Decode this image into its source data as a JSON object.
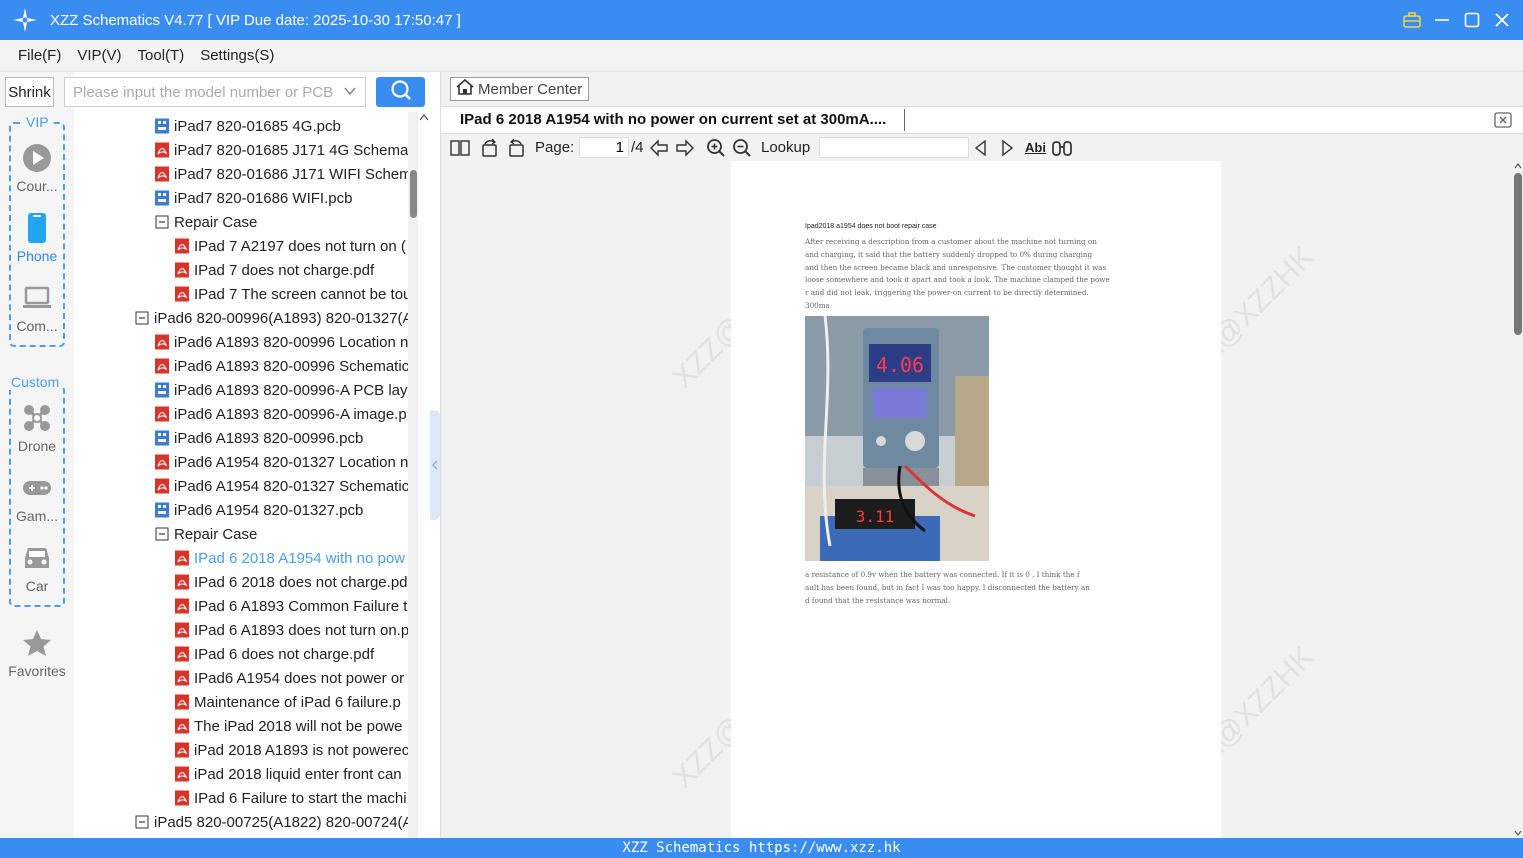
{
  "window": {
    "title": "XZZ Schematics V4.77 [ VIP Due date: 2025-10-30 17:50:47 ]"
  },
  "menu": {
    "items": [
      "File(F)",
      "VIP(V)",
      "Tool(T)",
      "Settings(S)"
    ]
  },
  "rail": {
    "shrink_label": "Shrink",
    "vip_group_label": "VIP",
    "custom_group_label": "Custom",
    "items": {
      "course": "Cour...",
      "phone": "Phone",
      "computer": "Com...",
      "drone": "Drone",
      "game": "Gam...",
      "car": "Car",
      "favorites": "Favorites"
    }
  },
  "search": {
    "placeholder": "Please input the model number or PCB"
  },
  "tree": {
    "rows": [
      {
        "label": "iPad7 820-01685 4G.pcb",
        "type": "pcb",
        "indent": 1
      },
      {
        "label": "iPad7 820-01685 J171 4G Schemat",
        "type": "pdf",
        "indent": 1
      },
      {
        "label": "iPad7 820-01686 J171 WIFI Schem",
        "type": "pdf",
        "indent": 1
      },
      {
        "label": "iPad7 820-01686 WIFI.pcb",
        "type": "pcb",
        "indent": 1
      },
      {
        "label": "Repair Case",
        "type": "folder",
        "indent": 1
      },
      {
        "label": "IPad 7 A2197 does not turn on (",
        "type": "pdf",
        "indent": 2
      },
      {
        "label": "IPad 7 does not charge.pdf",
        "type": "pdf",
        "indent": 2
      },
      {
        "label": "IPad 7 The screen cannot be tou",
        "type": "pdf",
        "indent": 2
      },
      {
        "label": "iPad6 820-00996(A1893) 820-01327(A",
        "type": "folder",
        "indent": 0
      },
      {
        "label": "iPad6 A1893 820-00996 Location n",
        "type": "pdf",
        "indent": 1
      },
      {
        "label": "iPad6 A1893 820-00996 Schematic",
        "type": "pdf",
        "indent": 1
      },
      {
        "label": "iPad6 A1893 820-00996-A PCB laye",
        "type": "pcb",
        "indent": 1
      },
      {
        "label": "iPad6 A1893 820-00996-A image.p",
        "type": "pdf",
        "indent": 1
      },
      {
        "label": "iPad6 A1893 820-00996.pcb",
        "type": "pcb",
        "indent": 1
      },
      {
        "label": "iPad6 A1954 820-01327 Location n",
        "type": "pdf",
        "indent": 1
      },
      {
        "label": "iPad6 A1954 820-01327 Schematic",
        "type": "pdf",
        "indent": 1
      },
      {
        "label": "iPad6 A1954 820-01327.pcb",
        "type": "pcb",
        "indent": 1
      },
      {
        "label": "Repair Case",
        "type": "folder",
        "indent": 1
      },
      {
        "label": "IPad 6 2018 A1954 with no pow",
        "type": "pdf",
        "indent": 2,
        "selected": true
      },
      {
        "label": "IPad 6 2018 does not charge.pd",
        "type": "pdf",
        "indent": 2
      },
      {
        "label": "IPad 6 A1893 Common Failure t",
        "type": "pdf",
        "indent": 2
      },
      {
        "label": "IPad 6 A1893 does not turn on.p",
        "type": "pdf",
        "indent": 2
      },
      {
        "label": "IPad 6 does not charge.pdf",
        "type": "pdf",
        "indent": 2
      },
      {
        "label": "IPad6 A1954 does not power or",
        "type": "pdf",
        "indent": 2
      },
      {
        "label": "Maintenance of iPad 6 failure.p",
        "type": "pdf",
        "indent": 2
      },
      {
        "label": "The iPad 2018 will not be powe",
        "type": "pdf",
        "indent": 2
      },
      {
        "label": "iPad 2018 A1893 is not powerec",
        "type": "pdf",
        "indent": 2
      },
      {
        "label": "iPad 2018 liquid enter front can",
        "type": "pdf",
        "indent": 2
      },
      {
        "label": "IPad 6 Failure to start the machi",
        "type": "pdf",
        "indent": 2
      },
      {
        "label": "iPad5 820-00725(A1822) 820-00724(A",
        "type": "folder",
        "indent": 0
      }
    ]
  },
  "viewer": {
    "member_center_label": "Member Center",
    "doc_title": "IPad 6 2018 A1954 with no power on current set at 300mA....",
    "page_label": "Page:",
    "page_current": "1",
    "page_total": "/4",
    "lookup_label": "Lookup",
    "abi_label": "Abi"
  },
  "document": {
    "heading": "Ipad2018 a1954 does not boot repair case",
    "para1": [
      "After receiving a description from a customer about the machine not turning on",
      "and charging, it said that the battery suddenly dropped to 0% during charging",
      "and then the screen became black and unresponsive. The customer thought it was",
      "loose somewhere and took it apart and took a look. The machine clamped the powe",
      "r and did not leak, triggering the power-on current to be directly determined.",
      "300ma"
    ],
    "psu_reading": "4.06",
    "meter_reading": "3.11",
    "para2": [
      "a resistance of 0.9v when the battery was connected. If it is 0 , I think the f",
      "ault has been found, but in fact I was too happy. I disconnected the battery an",
      "d found that the resistance was normal."
    ],
    "watermark": "XZZ@XZZHK"
  },
  "status": {
    "text": "XZZ Schematics https://www.xzz.hk"
  },
  "colors": {
    "accent": "#3a8df0",
    "selected_text": "#4a9df0",
    "pdf_icon": "#d9342b",
    "pcb_icon": "#3a7bd5"
  }
}
